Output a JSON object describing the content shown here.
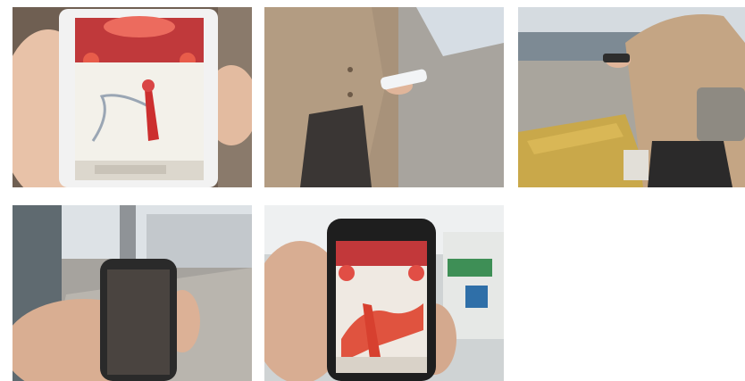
{
  "gallery": {
    "photos": [
      {
        "id": "photo-1",
        "subject": "hand-holding-phone-map-app"
      },
      {
        "id": "photo-2",
        "subject": "person-using-phone-on-sidewalk"
      },
      {
        "id": "photo-3",
        "subject": "person-with-bag-using-phone-on-street"
      },
      {
        "id": "photo-4",
        "subject": "hand-holding-phone-toward-street"
      },
      {
        "id": "photo-5",
        "subject": "hand-holding-phone-route-app"
      }
    ]
  }
}
